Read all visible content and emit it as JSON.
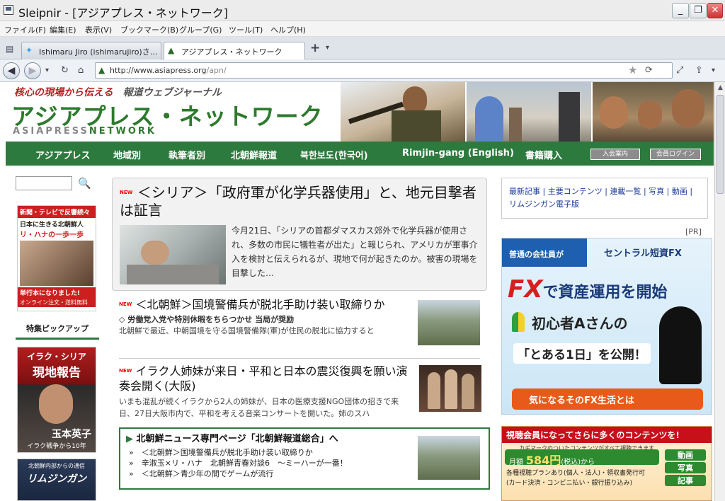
{
  "window": {
    "title": "Sleipnir - [アジアプレス・ネットワーク]",
    "btn_min": "_",
    "btn_max": "❐",
    "btn_close": "✕"
  },
  "menu": [
    "ファイル(F)",
    "編集(E)",
    "表示(V)",
    "ブックマーク(B)",
    "グループ(G)",
    "ツール(T)",
    "ヘルプ(H)"
  ],
  "tabs": [
    {
      "label": "Ishimaru Jiro (ishimarujiro)さ…",
      "icon": "twitter-bird-icon"
    },
    {
      "label": "アジアプレス・ネットワーク",
      "icon": "asiapress-logo-icon"
    }
  ],
  "tab_add": "+",
  "tab_menu": "▾",
  "nav": {
    "back": "◀",
    "forward": "▶",
    "dropdown": "▾",
    "reload": "↻",
    "home": "⌂"
  },
  "address": {
    "url_main": "http://www.asiapress.org",
    "url_rest": "/apn/"
  },
  "toolbar_right": {
    "star": "★",
    "go": "⟳",
    "expand": "⤢",
    "share": "⇪",
    "more": "▾"
  },
  "site": {
    "tagline_red": "核心の現場から伝える",
    "tagline_gray": "報道ウェブジャーナル",
    "logo": "アジアプレス・ネットワーク",
    "logo_sub_a": "ASIAPRESS",
    "logo_sub_b": "NETWORK"
  },
  "navmenu": [
    "アジアプレス",
    "地域別",
    "執筆者別",
    "北朝鮮報道",
    "북한보도(한국어)",
    "Rimjin-gang (English)",
    "書籍購入"
  ],
  "nav_buttons": [
    "入会案内",
    "会員ログイン"
  ],
  "left": {
    "search_icon": "🔍",
    "banner1": {
      "line1": "新聞・テレビで反響続々",
      "line2": "日本に生きる北朝鮮人",
      "line3": "リ・ハナの一歩一歩",
      "line4": "単行本になりました!",
      "line5": "オンライン注文・送料無料"
    },
    "section": "特集ピックアップ",
    "banner2": {
      "line1": "イラク・シリア",
      "line2": "現地報告",
      "line3": "玉本英子",
      "line4": "イラク戦争から10年"
    },
    "banner3": {
      "line1": "北朝鮮内部からの通信",
      "line2": "リムジンガン"
    }
  },
  "new_label": "NEW",
  "feature": {
    "title": "＜シリア＞「政府軍が化学兵器使用」と、地元目撃者は証言",
    "text": "今月21日、「シリアの首都ダマスカス郊外で化学兵器が使用され、多数の市民に犠牲者が出た」と報じられ、アメリカが軍事介入を検討と伝えられるが、現地で何が起きたのか。被害の現場を目撃した…"
  },
  "articles": [
    {
      "title": "＜北朝鮮＞国境警備兵が脱北手助け装い取締りか",
      "sub": "◇ 労働党入党や特別休暇をちらつかせ 当局が奨励",
      "text": "北朝鮮で最近、中朝国境を守る国境警備隊(軍)が住民の脱北に協力すると"
    },
    {
      "title": "イラク人姉妹が来日・平和と日本の震災復興を願い演奏会開く(大阪)",
      "sub": "",
      "text": "いまも混乱が続くイラクから2人の姉妹が、日本の医療支援NGO団体の招きで来日、27日大阪市内で、平和を考える音楽コンサートを開いた。姉のスハ"
    }
  ],
  "nk_box": {
    "title": "北朝鮮ニュース専門ページ「北朝鮮報道総合」へ",
    "items": [
      "＜北朝鮮＞国境警備兵が脱北手助け装い取締りか",
      "辛淑玉×リ・ハナ　北朝鮮青春対談6　～ミーハーが一番！",
      "＜北朝鮮＞青少年の間でゲームが流行"
    ],
    "bullet": "»"
  },
  "right_links": [
    "最新記事",
    "主要コンテンツ",
    "連載一覧",
    "写真",
    "動画",
    "リムジンガン電子版"
  ],
  "link_sep": "|",
  "pr": "[PR]",
  "ad1": {
    "corner": "普通の会社員が",
    "brand": "セントラル短資FX",
    "fx": "FX",
    "headline_rest": "で資産運用を開始",
    "person": "初心者Aさんの",
    "day": "「とある1日」を公開！",
    "cta": "気になるそのFX生活とは"
  },
  "ad2": {
    "title": "視聴会員になってさらに多くのコンテンツを!",
    "sub": "カギマークのついたコンテンツがすべて視聴できます",
    "price_prefix": "月額",
    "price": "584円",
    "tax": "(税込)",
    "price_suffix": "から",
    "note1": "各種視聴プランあり(個人・法人)・領収書発行可",
    "note2": "(カード決済・コンビニ払い・銀行振り込み)",
    "tags": [
      "動画",
      "写真",
      "記事"
    ]
  }
}
